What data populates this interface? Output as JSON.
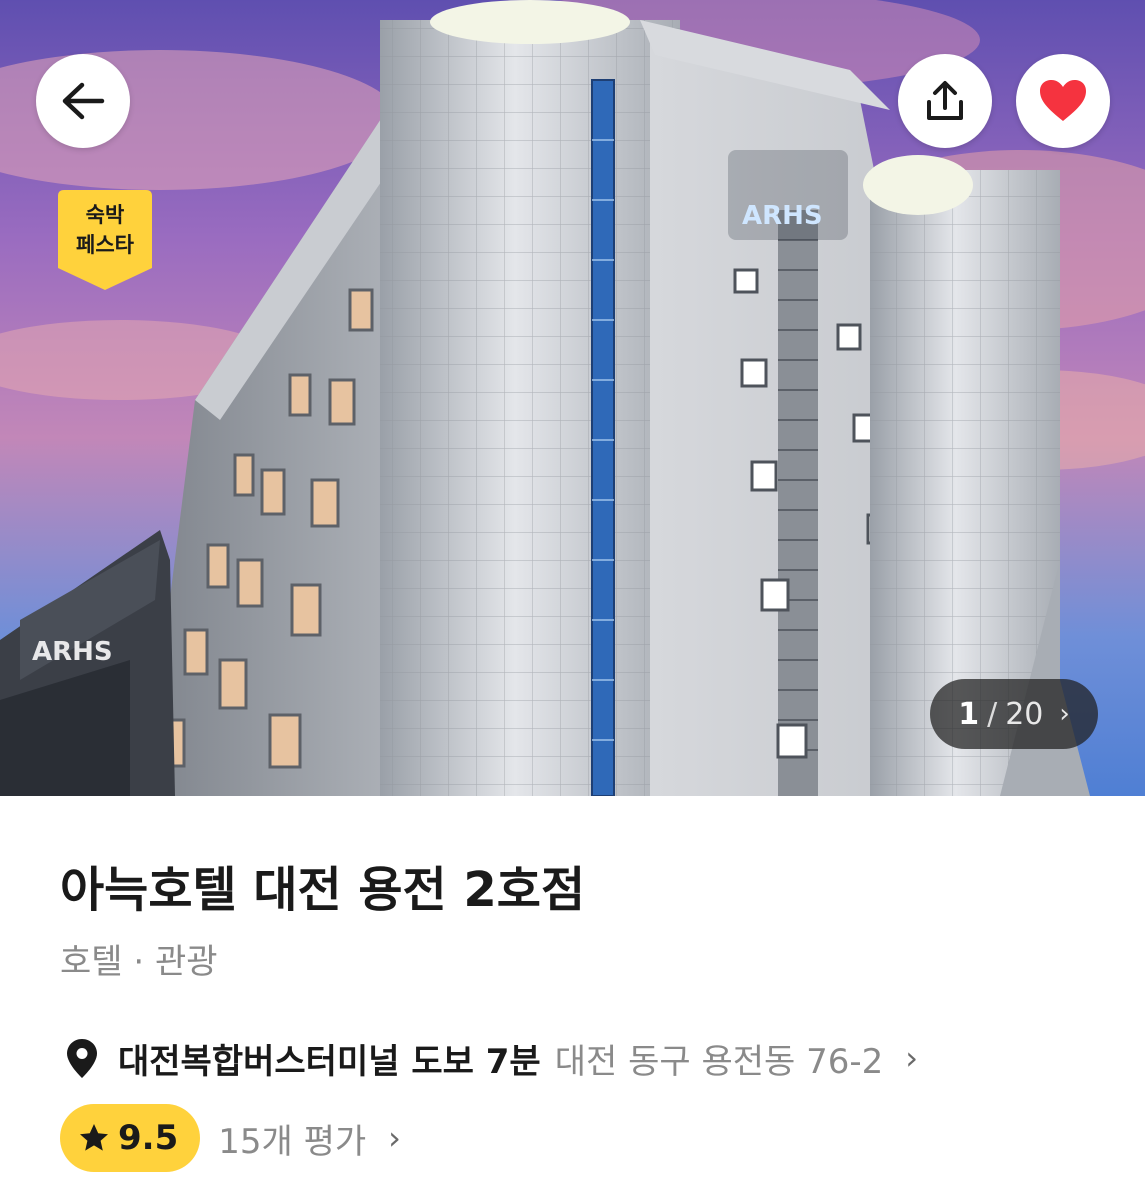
{
  "gallery": {
    "current": "1",
    "separator": "/",
    "total": "20",
    "back_icon": "arrow-left-icon",
    "share_icon": "share-icon",
    "like_icon": "heart-icon",
    "liked": true,
    "like_color": "#f5333f",
    "counter_chevron": "›"
  },
  "badge": {
    "line1": "숙박",
    "line2": "페스타",
    "color": "#ffd23c"
  },
  "hotel": {
    "name": "아늑호텔 대전 용전 2호점",
    "category": "호텔 · 관광",
    "transit": "대전복합버스터미널 도보 7분",
    "address": "대전 동구 용전동 76-2",
    "location_icon": "location-pin-icon",
    "chevron": "›"
  },
  "rating": {
    "score": "9.5",
    "reviews": "15개 평가",
    "star_icon": "star-icon",
    "pill_color": "#ffd23c",
    "chevron": "›"
  }
}
